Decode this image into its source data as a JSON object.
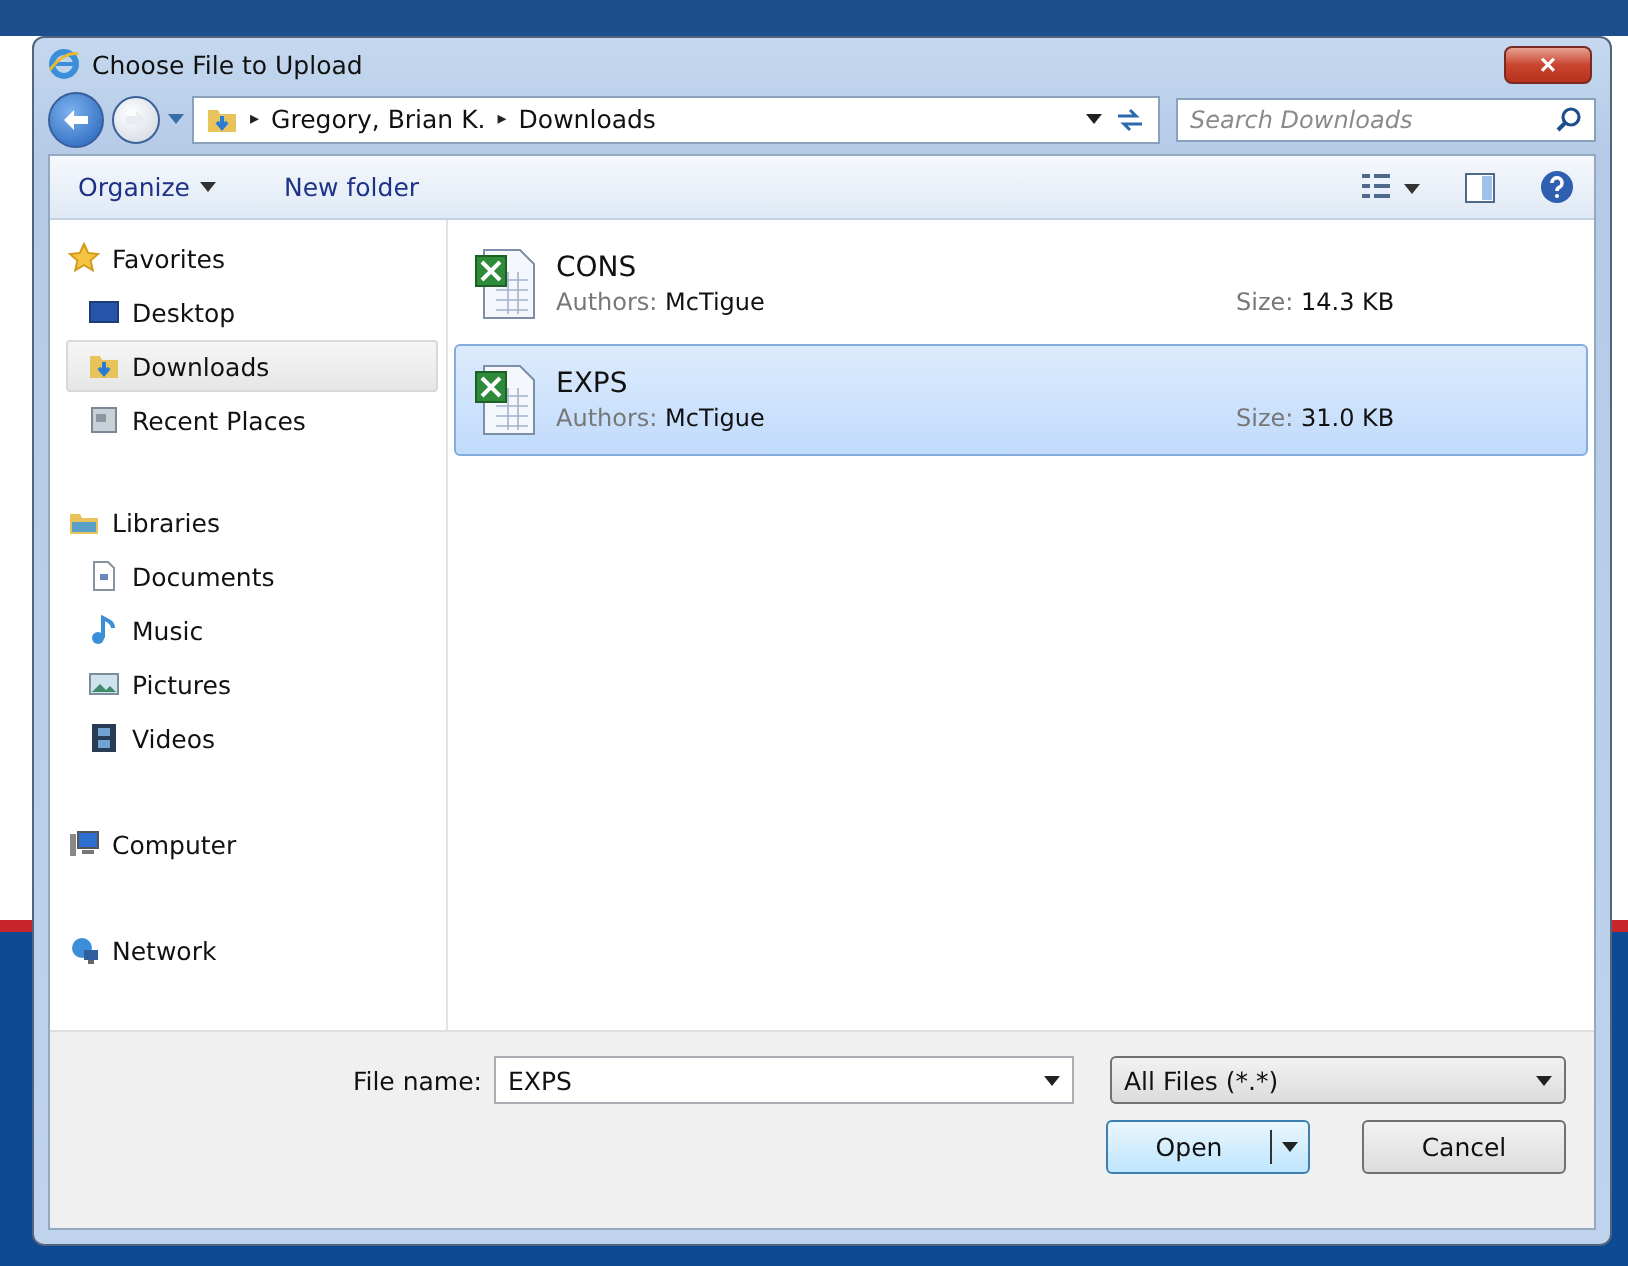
{
  "window": {
    "title": "Choose File to Upload",
    "close": "×"
  },
  "address": {
    "path": [
      "Gregory, Brian K.",
      "Downloads"
    ],
    "separator": "▸",
    "search_placeholder": "Search Downloads"
  },
  "toolbar": {
    "items": [
      {
        "label": "Organize",
        "dropdown": true
      },
      {
        "label": "New folder",
        "dropdown": false
      }
    ]
  },
  "sidebar": [
    {
      "label": "Favorites",
      "kind": "star",
      "selected": false,
      "children": [
        {
          "label": "Desktop",
          "kind": "desktop",
          "selected": false
        },
        {
          "label": "Downloads",
          "kind": "downloads",
          "selected": true
        },
        {
          "label": "Recent Places",
          "kind": "recent",
          "selected": false
        }
      ]
    },
    {
      "label": "Libraries",
      "kind": "library",
      "selected": false,
      "children": [
        {
          "label": "Documents",
          "kind": "documents",
          "selected": false
        },
        {
          "label": "Music",
          "kind": "music",
          "selected": false
        },
        {
          "label": "Pictures",
          "kind": "pictures",
          "selected": false
        },
        {
          "label": "Videos",
          "kind": "videos",
          "selected": false
        }
      ]
    },
    {
      "label": "Computer",
      "kind": "computer",
      "selected": false
    },
    {
      "label": "Network",
      "kind": "network",
      "selected": false
    }
  ],
  "files": [
    {
      "name": "CONS",
      "authors_label": "Authors:",
      "author": "McTigue",
      "size_label": "Size:",
      "size": "14.3 KB",
      "selected": false
    },
    {
      "name": "EXPS",
      "authors_label": "Authors:",
      "author": "McTigue",
      "size_label": "Size:",
      "size": "31.0 KB",
      "selected": true
    }
  ],
  "footer": {
    "file_name_label": "File name:",
    "file_name": "EXPS",
    "file_type": "All Files (*.*)",
    "buttons": [
      {
        "label": "Open",
        "kind": "split"
      },
      {
        "label": "Cancel",
        "kind": "plain"
      }
    ]
  }
}
